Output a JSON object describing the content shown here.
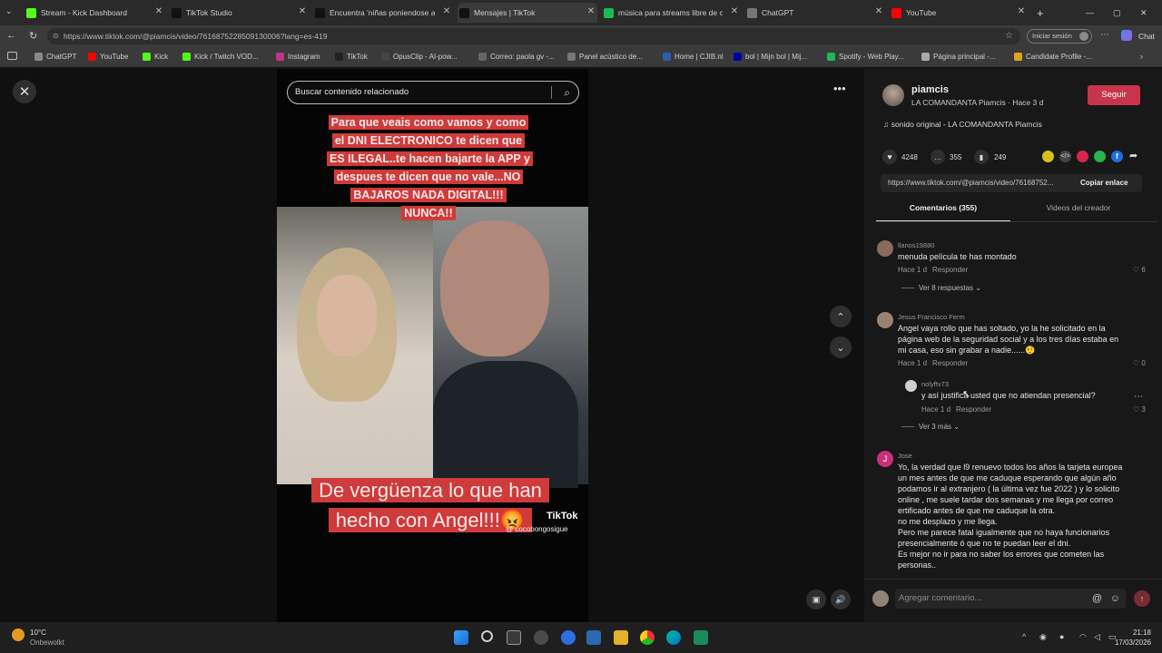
{
  "tabs": [
    {
      "label": "Stream - Kick Dashboard",
      "icon": "kick-icon",
      "color": "#53fc18"
    },
    {
      "label": "TikTok Studio",
      "icon": "tiktok-icon",
      "color": "#111111"
    },
    {
      "label": "Encuentra 'niñas poniendose acid",
      "icon": "tiktok-icon",
      "color": "#111111"
    },
    {
      "label": "Mensajes | TikTok",
      "icon": "tiktok-icon",
      "color": "#111111"
    },
    {
      "label": "música para streams libre de cop",
      "icon": "spotify-icon",
      "color": "#1db954"
    },
    {
      "label": "ChatGPT",
      "icon": "chatgpt-icon",
      "color": "#777777"
    },
    {
      "label": "YouTube",
      "icon": "youtube-icon",
      "color": "#ff0000"
    }
  ],
  "url": "https://www.tiktok.com/@piamcis/video/7616875228509130006?lang=es-419",
  "sign_in": "Iniciar sesión",
  "chat": "Chat",
  "bookmarks": [
    {
      "label": "ChatGPT",
      "color": "#888888"
    },
    {
      "label": "YouTube",
      "color": "#ff0000"
    },
    {
      "label": "Kick",
      "color": "#53fc18"
    },
    {
      "label": "Kick / Twitch VOD...",
      "color": "#53fc18"
    },
    {
      "label": "Instagram",
      "color": "#c13584"
    },
    {
      "label": "TikTok",
      "color": "#222222"
    },
    {
      "label": "OpusClip - AI-pow...",
      "color": "#444444"
    },
    {
      "label": "Correo: paola gv -...",
      "color": "#666666"
    },
    {
      "label": "Panel acústico de...",
      "color": "#777777"
    },
    {
      "label": "Home | CJIB.nl",
      "color": "#2a5db0"
    },
    {
      "label": "bol | Mijn bol | Mij...",
      "color": "#0000a4"
    },
    {
      "label": "Spotify - Web Play...",
      "color": "#1db954"
    },
    {
      "label": "Página principal -...",
      "color": "#aaaaaa"
    },
    {
      "label": "Candidate Profile -...",
      "color": "#e0a020"
    }
  ],
  "search_placeholder": "Buscar contenido relacionado",
  "video": {
    "caption_top": "Para que veais como vamos y como el DNI ELECTRONICO te dicen que ES ILEGAL..te hacen bajarte la APP y despues te dicen que no vale...NO BAJAROS NADA DIGITAL!!! NUNCA!!",
    "caption_bottom": "De vergüenza lo que han hecho con Angel!!!😡",
    "watermark_brand": "TikTok",
    "watermark_user": "@ cocobongosigue"
  },
  "creator": {
    "username": "piamcis",
    "subline": "LA COMANDANTA Piamcis · Hace 3 d",
    "follow": "Seguir",
    "sound": "sonido original - LA COMANDANTA Piamcis"
  },
  "stats": {
    "likes": "4248",
    "comments": "355",
    "saves": "249"
  },
  "share_url": "https://www.tiktok.com/@piamcis/video/76168752...",
  "copy_link": "Copiar enlace",
  "panel_tabs": {
    "comments": "Comentarios (355)",
    "creator_videos": "Videos del creador"
  },
  "comments": [
    {
      "user": "llanos19880",
      "text": "menuda película te has montado",
      "time": "Hace 1 d",
      "reply": "Responder",
      "likes": "6",
      "more": "Ver 8 respuestas"
    },
    {
      "user": "Jesus Francisco Ferm",
      "text": "Angel vaya rollo que has soltado, yo la he solicitado en la página web de la seguridad social y a los tres días estaba en mi casa, eso sin grabar a nadie......🤨",
      "time": "Hace 1 d",
      "reply": "Responder",
      "likes": "0",
      "sub": {
        "user": "nolyftv73",
        "text": "y así justifica usted que no atiendan presencial?",
        "time": "Hace 1 d",
        "reply": "Responder",
        "likes": "3"
      },
      "more": "Ver 3 más"
    },
    {
      "user": "Jose",
      "avatar_letter": "J",
      "text": "Yo, la verdad que l9 renuevo todos los años la tarjeta europea un mes antes de que me caduque esperando que algún año podamos ir al extranjero ( la última vez fue 2022 ) y lo solicito online , me suele tardar dos semanas y me llega por correo ertificado antes de que me caduque la otra.\nno me desplazo y me llega.\nPero me parece fatal igualmente que no haya funcionarios presencialmente ó que no te puedan leer el dni.\nEs mejor no ir para no saber los errores que cometen las personas.."
    }
  ],
  "comment_placeholder": "Agregar comentario...",
  "taskbar": {
    "weather_temp": "10°C",
    "weather_desc": "Onbewolkt",
    "time": "21:18",
    "date": "17/03/2026"
  }
}
